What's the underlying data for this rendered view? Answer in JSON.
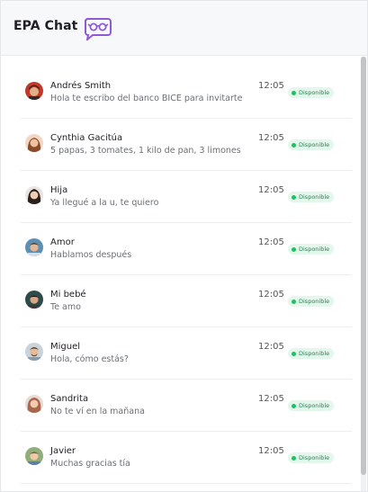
{
  "app": {
    "title": "EPA Chat",
    "logo_icon": "chat-glasses-icon"
  },
  "status_color": "#22c064",
  "chats": [
    {
      "name": "Andrés Smith",
      "preview": "Hola te escribo del banco BICE para invitarte",
      "time": "12:05",
      "status": "Disponible",
      "avatar_icon": "avatar-man-dark-hair"
    },
    {
      "name": "Cynthia Gacitúa",
      "preview": "5 papas, 3 tomates, 1 kilo de pan, 3 limones",
      "time": "12:05",
      "status": "Disponible",
      "avatar_icon": "avatar-woman-brown-hair"
    },
    {
      "name": "Hija",
      "preview": "Ya llegué a la u, te quiero",
      "time": "12:05",
      "status": "Disponible",
      "avatar_icon": "avatar-girl-dark-hair"
    },
    {
      "name": "Amor",
      "preview": "Hablamos después",
      "time": "12:05",
      "status": "Disponible",
      "avatar_icon": "avatar-man-blue"
    },
    {
      "name": "Mi bebé",
      "preview": "Te amo",
      "time": "12:05",
      "status": "Disponible",
      "avatar_icon": "avatar-boy-dark"
    },
    {
      "name": "Miguel",
      "preview": "Hola, cómo estás?",
      "time": "12:05",
      "status": "Disponible",
      "avatar_icon": "avatar-man-beard"
    },
    {
      "name": "Sandrita",
      "preview": "No te ví en la mañana",
      "time": "12:05",
      "status": "Disponible",
      "avatar_icon": "avatar-woman-curly"
    },
    {
      "name": "Javier",
      "preview": "Muchas gracias tía",
      "time": "12:05",
      "status": "Disponible",
      "avatar_icon": "avatar-boy-green"
    }
  ]
}
